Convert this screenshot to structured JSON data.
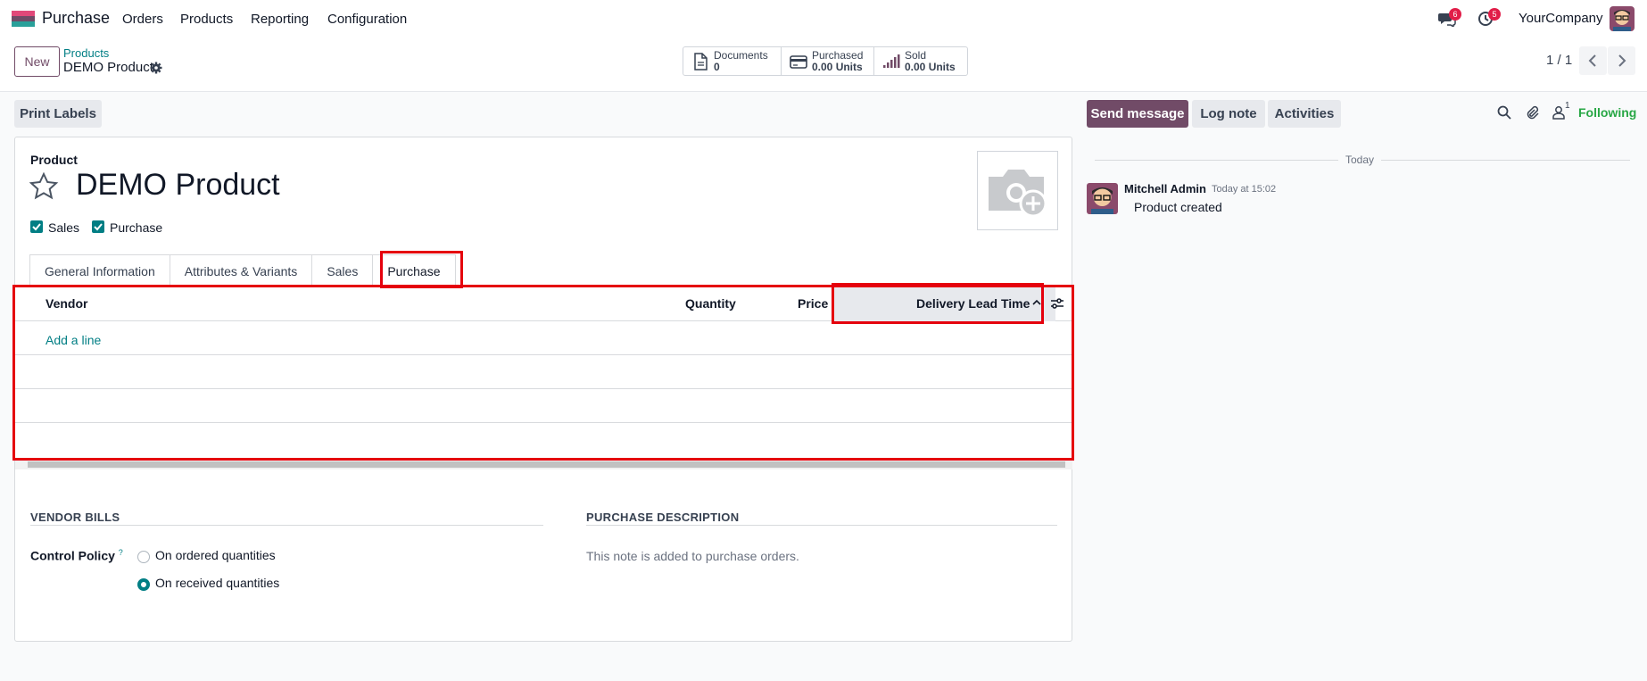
{
  "app": {
    "name": "Purchase"
  },
  "menu": {
    "orders": "Orders",
    "products": "Products",
    "reporting": "Reporting",
    "configuration": "Configuration"
  },
  "systray": {
    "messages_count": "6",
    "activities_count": "5",
    "company": "YourCompany"
  },
  "control_panel": {
    "new_label": "New",
    "breadcrumb_parent": "Products",
    "breadcrumb_current": "DEMO Product",
    "pager": "1 / 1"
  },
  "smart_buttons": [
    {
      "label": "Documents",
      "value": "0",
      "icon": "file-icon"
    },
    {
      "label": "Purchased",
      "value": "0.00 Units",
      "icon": "credit-card-icon"
    },
    {
      "label": "Sold",
      "value": "0.00 Units",
      "icon": "signal-icon"
    }
  ],
  "actions": {
    "print_labels": "Print Labels"
  },
  "form": {
    "type_label": "Product",
    "name": "DEMO Product",
    "checkbox_sales": "Sales",
    "checkbox_purchase": "Purchase",
    "tabs": [
      "General Information",
      "Attributes & Variants",
      "Sales",
      "Purchase"
    ],
    "active_tab": "Purchase",
    "table": {
      "columns": {
        "vendor": "Vendor",
        "quantity": "Quantity",
        "price": "Price",
        "lead_time": "Delivery Lead Time"
      },
      "add_line": "Add a line"
    },
    "vendor_bills": {
      "title": "VENDOR BILLS",
      "control_policy_label": "Control Policy",
      "help": "?",
      "options": [
        "On ordered quantities",
        "On received quantities"
      ],
      "selected": "On received quantities"
    },
    "purchase_description": {
      "title": "PURCHASE DESCRIPTION",
      "placeholder": "This note is added to purchase orders."
    }
  },
  "chatter": {
    "send_message": "Send message",
    "log_note": "Log note",
    "activities": "Activities",
    "followers_count": "1",
    "following": "Following",
    "date_separator": "Today",
    "message": {
      "author": "Mitchell Admin",
      "date": "Today at 15:02",
      "body": "Product created"
    }
  },
  "colors": {
    "brand": "#714b67",
    "link": "#017e84",
    "highlight": "#e5000d",
    "following": "#28a745"
  }
}
